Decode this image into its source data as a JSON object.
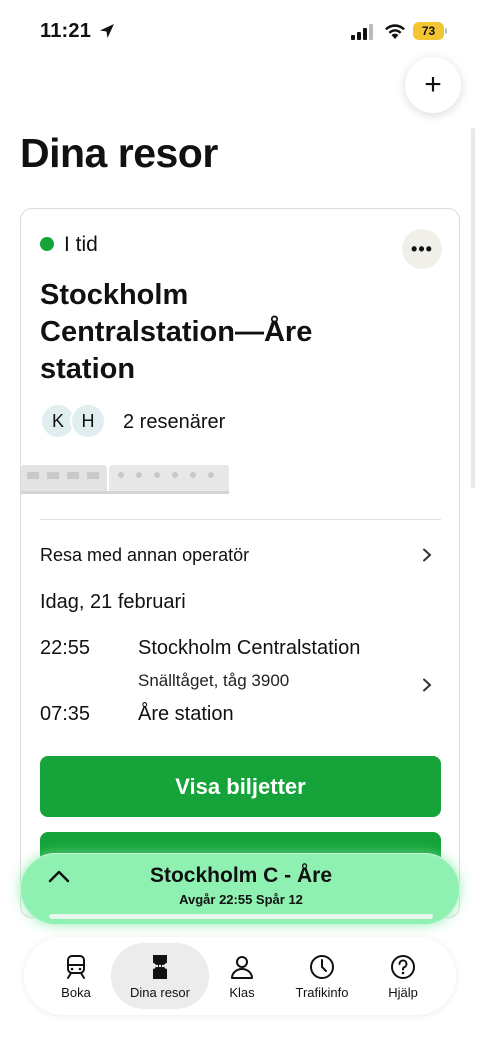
{
  "status_bar": {
    "time": "11:21",
    "battery": "73"
  },
  "header": {
    "title": "Dina resor",
    "add_symbol": "+"
  },
  "trip_card": {
    "status": "I tid",
    "status_color": "#15a33a",
    "route": "Stockholm Centralstation—Åre station",
    "passenger_initials": [
      "K",
      "H"
    ],
    "passengers": "2 resenärer",
    "operator_note": "Resa med annan operatör",
    "date": "Idag, 21 februari",
    "departure": {
      "time": "22:55",
      "station": "Stockholm Centralstation"
    },
    "train": "Snälltåget, tåg 3900",
    "arrival": {
      "time": "07:35",
      "station": "Åre station"
    },
    "tickets_button": "Visa biljetter",
    "accent_color": "#15a33a"
  },
  "trip_pill": {
    "title": "Stockholm C - Åre",
    "subtitle": "Avgår 22:55  Spår 12"
  },
  "tab_bar": {
    "tabs": [
      {
        "label": "Boka",
        "icon": "train-icon"
      },
      {
        "label": "Dina resor",
        "icon": "ticket-icon"
      },
      {
        "label": "Klas",
        "icon": "person-icon"
      },
      {
        "label": "Trafikinfo",
        "icon": "clock-icon"
      },
      {
        "label": "Hjälp",
        "icon": "help-icon"
      }
    ],
    "active_index": 1
  }
}
